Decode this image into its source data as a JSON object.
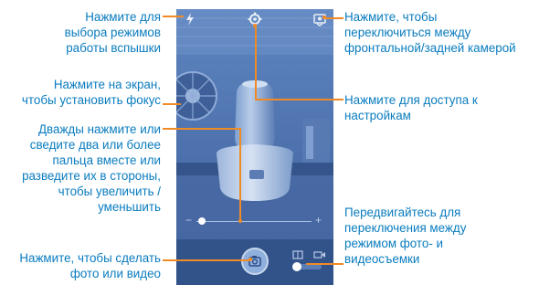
{
  "colors": {
    "callout_text": "#0a7cbf",
    "leader_line": "#f08a24",
    "screen_tint": "#4a6fab"
  },
  "callouts": {
    "flash": [
      "Нажмите для",
      "выбора режимов",
      "работы вспышки"
    ],
    "focus": [
      "Нажмите на экран,",
      "чтобы установить фокус"
    ],
    "zoom": [
      "Дважды нажмите или",
      "сведите два или более",
      "пальца вместе или",
      "разведите их в стороны,",
      "чтобы увеличить /",
      "уменьшить"
    ],
    "shutter": [
      "Нажмите, чтобы сделать",
      "фото или видео"
    ],
    "switch_camera": [
      "Нажмите, чтобы",
      "переключиться между",
      "фронтальной/задней камерой"
    ],
    "settings": [
      "Нажмите для доступа к",
      "настройкам"
    ],
    "mode": [
      "Передвигайтесь для",
      "переключения между",
      "режимом фото- и",
      "видеосъемки"
    ]
  },
  "icons": {
    "flash": "flash-icon",
    "settings": "gear-icon",
    "switch_camera": "switch-camera-icon",
    "shutter": "shutter-icon",
    "photo_mode": "photo-mode-icon",
    "video_mode": "video-mode-icon",
    "zoom_minus": "minus-icon",
    "zoom_plus": "plus-icon"
  },
  "zoom_slider": {
    "minus": "−",
    "plus": "+",
    "level": 0.05
  }
}
